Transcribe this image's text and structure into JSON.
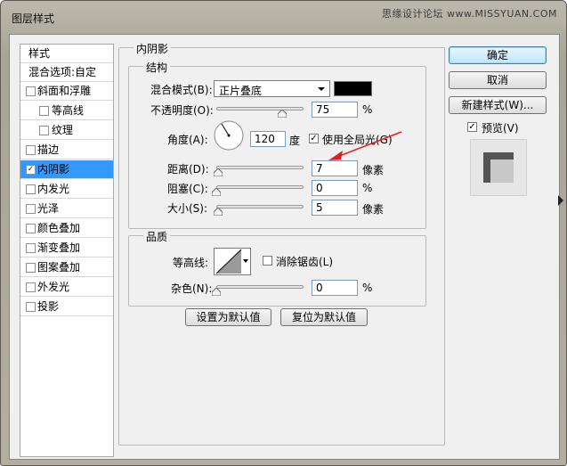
{
  "window": {
    "title": "图层样式",
    "watermark": "思缘设计论坛 www.MISSYUAN.COM"
  },
  "style_list": {
    "header": "样式",
    "blend_options": "混合选项:自定",
    "items": [
      {
        "label": "斜面和浮雕",
        "checked": false,
        "sub": false
      },
      {
        "label": "等高线",
        "checked": false,
        "sub": true
      },
      {
        "label": "纹理",
        "checked": false,
        "sub": true
      },
      {
        "label": "描边",
        "checked": false,
        "sub": false
      },
      {
        "label": "内阴影",
        "checked": true,
        "sub": false,
        "selected": true
      },
      {
        "label": "内发光",
        "checked": false,
        "sub": false
      },
      {
        "label": "光泽",
        "checked": false,
        "sub": false
      },
      {
        "label": "颜色叠加",
        "checked": false,
        "sub": false
      },
      {
        "label": "渐变叠加",
        "checked": false,
        "sub": false
      },
      {
        "label": "图案叠加",
        "checked": false,
        "sub": false
      },
      {
        "label": "外发光",
        "checked": false,
        "sub": false
      },
      {
        "label": "投影",
        "checked": false,
        "sub": false
      }
    ]
  },
  "panel": {
    "title": "内阴影",
    "structure": {
      "title": "结构",
      "blend_mode_label": "混合模式(B):",
      "blend_mode_value": "正片叠底",
      "shadow_color": "#000000",
      "opacity_label": "不透明度(O):",
      "opacity_value": "75",
      "opacity_unit": "%",
      "opacity_level": 0.75,
      "angle_label": "角度(A):",
      "angle_value": "120",
      "angle_unit": "度",
      "global_light_label": "使用全局光(G)",
      "global_light_checked": true,
      "distance_label": "距离(D):",
      "distance_value": "7",
      "distance_unit": "像素",
      "distance_level": 0.02,
      "choke_label": "阻塞(C):",
      "choke_value": "0",
      "choke_unit": "%",
      "choke_level": 0,
      "size_label": "大小(S):",
      "size_value": "5",
      "size_unit": "像素",
      "size_level": 0.02
    },
    "quality": {
      "title": "品质",
      "contour_label": "等高线:",
      "antialias_label": "消除锯齿(L)",
      "antialias_checked": false,
      "noise_label": "杂色(N):",
      "noise_value": "0",
      "noise_unit": "%",
      "noise_level": 0
    },
    "set_default": "设置为默认值",
    "reset_default": "复位为默认值"
  },
  "buttons": {
    "ok": "确定",
    "cancel": "取消",
    "new_style": "新建样式(W)...",
    "preview_label": "预览(V)",
    "preview_checked": true
  },
  "colors": {
    "selection": "#3399ff",
    "arrow": "#e02020"
  }
}
